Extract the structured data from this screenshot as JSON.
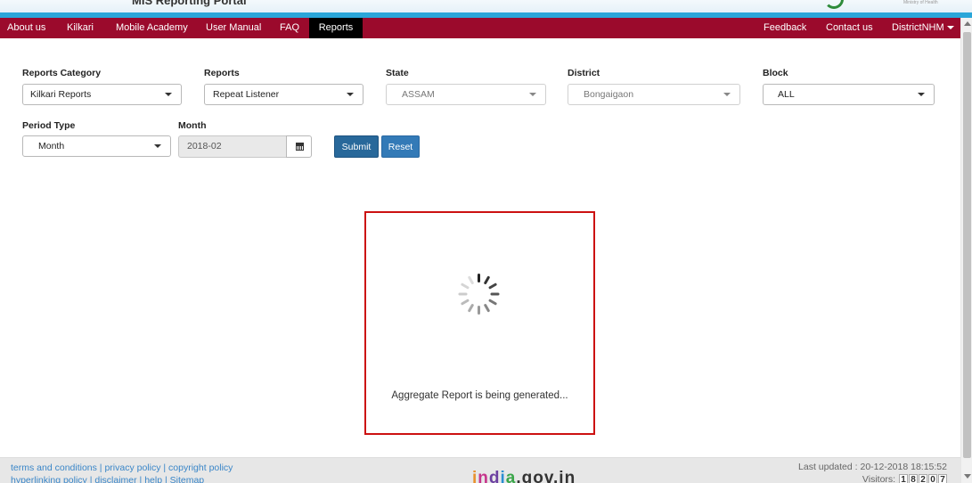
{
  "header": {
    "portal_title": "MIS Reporting Portal",
    "right_caption": "Ministry of Health"
  },
  "nav": {
    "left": [
      "About us",
      "Kilkari",
      "Mobile Academy",
      "User Manual",
      "FAQ",
      "Reports"
    ],
    "active": "Reports",
    "feedback": "Feedback",
    "contact": "Contact us",
    "user": "DistrictNHM"
  },
  "filters": {
    "reports_category": {
      "label": "Reports Category",
      "value": "Kilkari Reports"
    },
    "reports": {
      "label": "Reports",
      "value": "Repeat Listener"
    },
    "state": {
      "label": "State",
      "value": "ASSAM"
    },
    "district": {
      "label": "District",
      "value": "Bongaigaon"
    },
    "block": {
      "label": "Block",
      "value": "ALL"
    },
    "period_type": {
      "label": "Period Type",
      "value": "Month"
    },
    "month": {
      "label": "Month",
      "value": "2018-02"
    },
    "submit_label": "Submit",
    "reset_label": "Reset"
  },
  "loading": {
    "message": "Aggregate Report is being generated...",
    "icon": "spinner-icon"
  },
  "footer": {
    "links_row1": [
      "terms and conditions",
      "privacy policy",
      "copyright policy"
    ],
    "links_row2": [
      "hyperlinking policy",
      "disclaimer",
      "help",
      "Sitemap"
    ],
    "logo_text": "india.gov.in",
    "last_updated": "Last updated : 20-12-2018 18:15:52",
    "visitors_label": "Visitors:",
    "visitor_digits": [
      "1",
      "8",
      "2",
      "0",
      "7"
    ]
  },
  "colors": {
    "nav_bg": "#9b0a2c",
    "header_band": "#2aa6d9",
    "loading_border": "#cc1111",
    "submit_bg": "#28689a",
    "reset_bg": "#337ab7"
  }
}
